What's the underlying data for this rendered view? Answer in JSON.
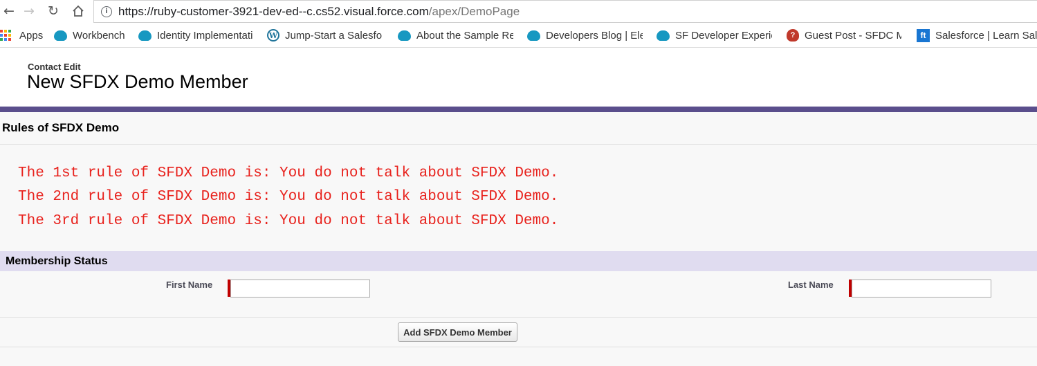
{
  "browser": {
    "url_main": "https://ruby-customer-3921-dev-ed--c.cs52.visual.force.com",
    "url_path": "/apex/DemoPage",
    "bookmarks": [
      {
        "label": "Apps",
        "icon": "apps-grid-icon"
      },
      {
        "label": "Workbench",
        "icon": "salesforce-cloud-icon"
      },
      {
        "label": "Identity Implementati",
        "icon": "salesforce-cloud-icon"
      },
      {
        "label": "Jump-Start a Salesfor",
        "icon": "wordpress-icon"
      },
      {
        "label": "About the Sample Re",
        "icon": "salesforce-cloud-icon"
      },
      {
        "label": "Developers Blog | Ele",
        "icon": "salesforce-cloud-icon"
      },
      {
        "label": "SF Developer Experie",
        "icon": "salesforce-cloud-icon"
      },
      {
        "label": "Guest Post - SFDC M",
        "icon": "hot-air-balloon-icon"
      },
      {
        "label": "Salesforce | Learn Sal",
        "icon": "ft-icon"
      }
    ]
  },
  "page": {
    "record_type": "Contact Edit",
    "title": "New SFDX Demo Member"
  },
  "rules_block": {
    "title": "Rules of SFDX Demo",
    "rules": [
      "The 1st rule of SFDX Demo is: You do not talk about SFDX Demo.",
      "The 2nd rule of SFDX Demo is: You do not talk about SFDX Demo.",
      "The 3rd rule of SFDX Demo is: You do not talk about SFDX Demo."
    ]
  },
  "membership": {
    "title": "Membership Status",
    "first_name_label": "First Name",
    "first_name_value": "",
    "last_name_label": "Last Name",
    "last_name_value": ""
  },
  "actions": {
    "add_label": "Add SFDX Demo Member"
  },
  "colors": {
    "accent": "#5a4e8c",
    "section_header": "#e0dcf0",
    "rule_text": "#e8221d",
    "required": "#c00000"
  }
}
